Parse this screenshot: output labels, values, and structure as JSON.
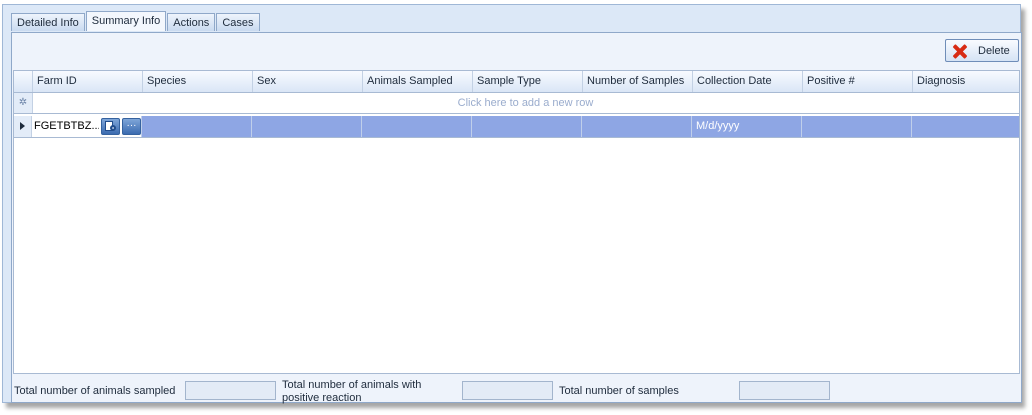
{
  "tabs": [
    {
      "label": "Detailed Info"
    },
    {
      "label": "Summary Info"
    },
    {
      "label": "Actions"
    },
    {
      "label": "Cases"
    }
  ],
  "toolbar": {
    "delete_label": "Delete"
  },
  "grid": {
    "columns": [
      {
        "label": "Farm ID"
      },
      {
        "label": "Species"
      },
      {
        "label": "Sex"
      },
      {
        "label": "Animals Sampled"
      },
      {
        "label": "Sample Type"
      },
      {
        "label": "Number of Samples"
      },
      {
        "label": "Collection Date"
      },
      {
        "label": "Positive #"
      },
      {
        "label": "Diagnosis"
      }
    ],
    "new_row_text": "Click here to add a new row",
    "new_row_glyph": "✲",
    "row": {
      "farm_id": "FGETBTBZ...",
      "species": "",
      "sex": "",
      "animals_sampled": "",
      "sample_type": "",
      "number_of_samples": "",
      "collection_date": "M/d/yyyy",
      "positive": "",
      "diagnosis": "",
      "ellipsis_glyph": "···"
    }
  },
  "footer": {
    "animals_sampled_label": "Total number of animals sampled",
    "animals_sampled_value": "",
    "positive_label": "Total number of animals with positive reaction",
    "positive_value": "",
    "samples_label": "Total number of samples",
    "samples_value": ""
  },
  "colors": {
    "selected_row": "#8ea6e4",
    "delete_icon": "#d82b14"
  }
}
